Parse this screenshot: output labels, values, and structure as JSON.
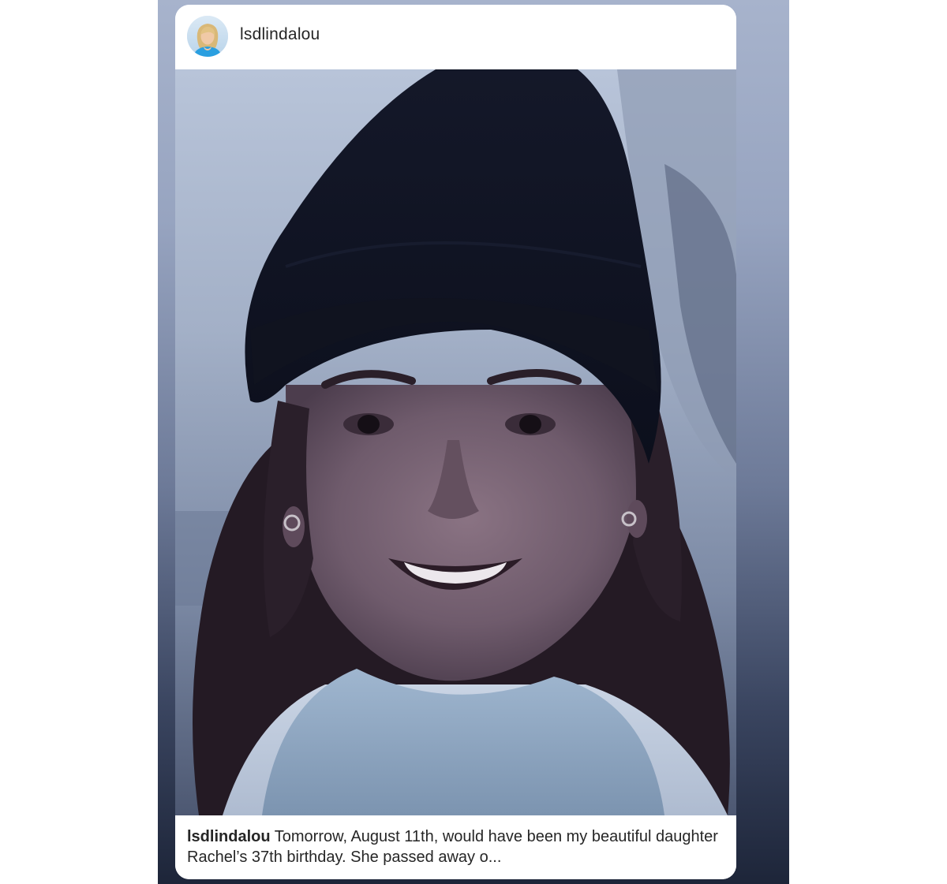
{
  "post": {
    "username": "lsdlindalou",
    "photo_icon": "portrait-photo",
    "avatar_icon": "profile-avatar",
    "caption": {
      "username": "lsdlindalou",
      "text": " Tomorrow, August 11th,  would have been my beautiful daughter Rachel’s 37th birthday.  She passed away o..."
    }
  },
  "colors": {
    "card_background": "#ffffff",
    "text": "#262626",
    "backdrop_top": "#a7b3cc",
    "backdrop_bottom": "#1d2539"
  }
}
